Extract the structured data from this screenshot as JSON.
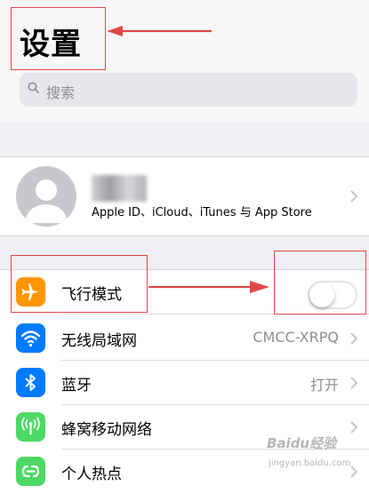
{
  "header": {
    "title": "设置",
    "search_placeholder": "搜索"
  },
  "account": {
    "subtitle": "Apple ID、iCloud、iTunes 与 App Store"
  },
  "settings": [
    {
      "label": "飞行模式",
      "icon": "airplane-icon",
      "color": "#ff9500",
      "toggle": false
    },
    {
      "label": "无线局域网",
      "icon": "wifi-icon",
      "color": "#007aff",
      "value": "CMCC-XRPQ"
    },
    {
      "label": "蓝牙",
      "icon": "bluetooth-icon",
      "color": "#007aff",
      "value": "打开"
    },
    {
      "label": "蜂窝移动网络",
      "icon": "cellular-icon",
      "color": "#4cd964"
    },
    {
      "label": "个人热点",
      "icon": "hotspot-icon",
      "color": "#4cd964"
    }
  ],
  "annotation_color": "#e04848",
  "watermark": {
    "logo": "Baidu经验",
    "url": "jingyan.baidu.com"
  }
}
